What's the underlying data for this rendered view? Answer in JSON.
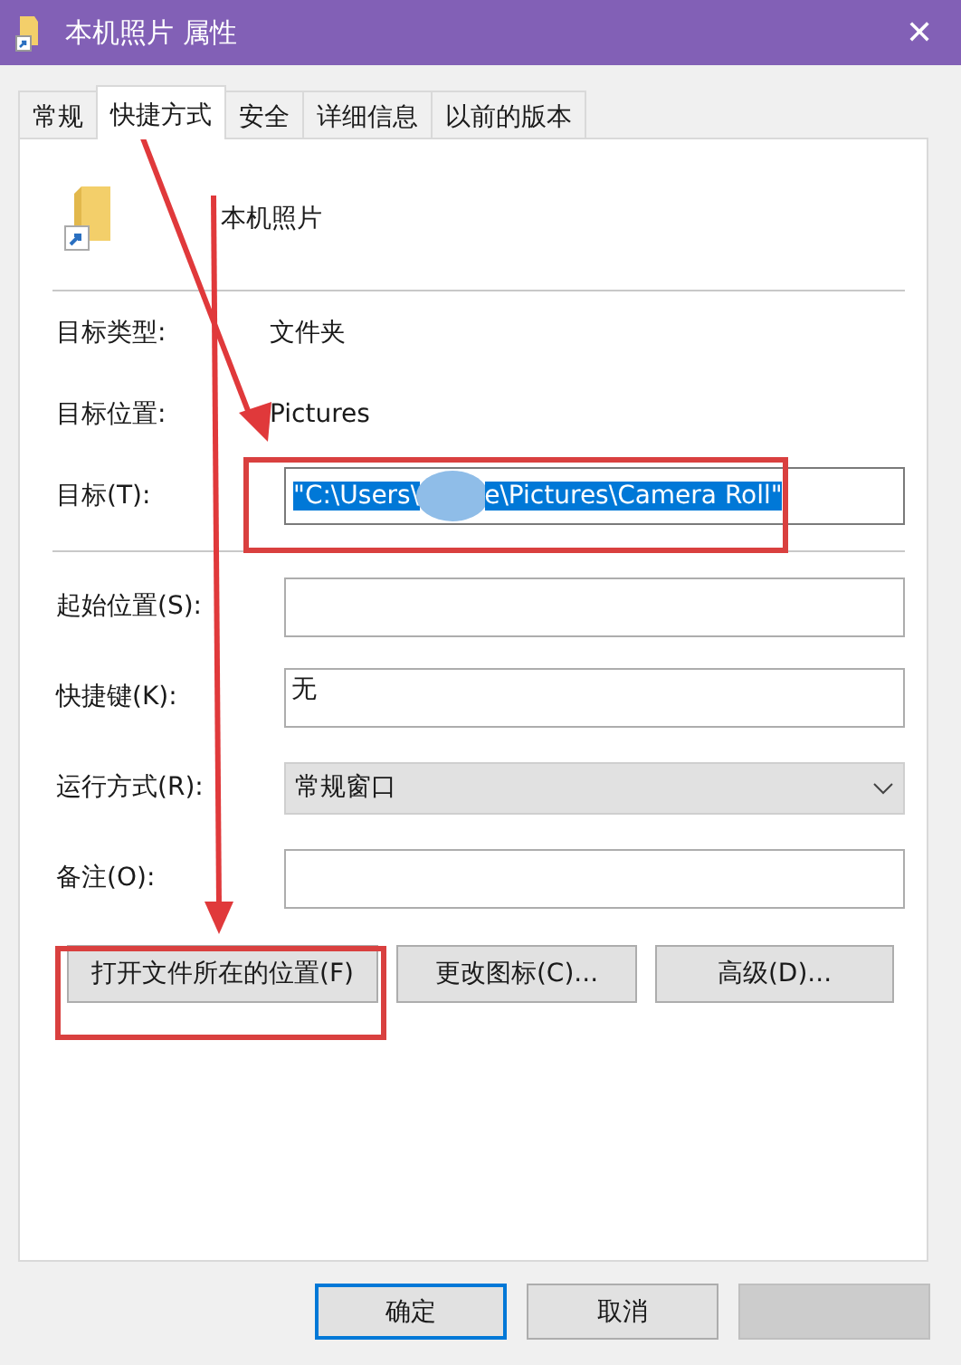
{
  "window": {
    "title": "本机照片 属性",
    "close": "✕"
  },
  "tabs": [
    {
      "label": "常规",
      "selected": false
    },
    {
      "label": "快捷方式",
      "selected": true
    },
    {
      "label": "安全",
      "selected": false
    },
    {
      "label": "详细信息",
      "selected": false
    },
    {
      "label": "以前的版本",
      "selected": false
    }
  ],
  "shortcut_name": "本机照片",
  "info": [
    {
      "label": "目标类型:",
      "value": "文件夹"
    },
    {
      "label": "目标位置:",
      "value": "Pictures"
    }
  ],
  "target": {
    "label": "目标(T):",
    "value_parts": [
      "\"C:\\Users\\",
      "e\\Pictures\\Camera Roll\""
    ],
    "selected": true
  },
  "fields": [
    {
      "kind": "input",
      "label": "起始位置(S):"
    },
    {
      "kind": "input",
      "label": "快捷键(K):",
      "value": "无"
    },
    {
      "kind": "select",
      "label": "运行方式(R):",
      "value": "常规窗口"
    },
    {
      "kind": "input",
      "label": "备注(O):"
    }
  ],
  "buttons": [
    {
      "label": "打开文件所在的位置(F)"
    },
    {
      "label": "更改图标(C)..."
    },
    {
      "label": "高级(D)..."
    }
  ],
  "dialog_buttons": [
    {
      "label": "确定",
      "default": true,
      "disabled": false
    },
    {
      "label": "取消",
      "default": false,
      "disabled": false
    },
    {
      "default": false,
      "disabled": true
    }
  ]
}
